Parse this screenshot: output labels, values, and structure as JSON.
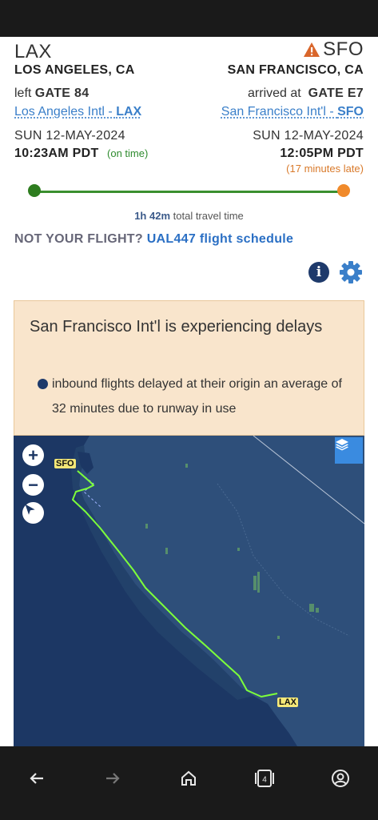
{
  "origin": {
    "code": "LAX",
    "city": "LOS ANGELES, CA",
    "gate_prefix": "left",
    "gate": "GATE 84",
    "airport_name": "Los Angeles Intl - ",
    "airport_code": "LAX",
    "date": "SUN 12-MAY-2024",
    "time": "10:23AM PDT",
    "status": "(on time)"
  },
  "destination": {
    "code": "SFO",
    "city": "SAN FRANCISCO, CA",
    "gate_prefix": "arrived at",
    "gate": "GATE E7",
    "airport_name": "San Francisco Int'l - ",
    "airport_code": "SFO",
    "date": "SUN 12-MAY-2024",
    "time": "12:05PM PDT",
    "status": "(17 minutes late)"
  },
  "progress": {
    "fraction": 1.0,
    "start_color": "#2e7d1f",
    "end_color": "#f08a2b"
  },
  "travel": {
    "duration": "1h 42m",
    "label": "total travel time"
  },
  "not_flight": {
    "prompt": "NOT YOUR FLIGHT?",
    "link": "UAL447 flight schedule"
  },
  "delay": {
    "title": "San Francisco Int'l is experiencing delays",
    "detail": "inbound flights delayed at their origin an average of 32 minutes due to runway in use"
  },
  "map": {
    "origin_label": "LAX",
    "destination_label": "SFO",
    "zoom_in": "+",
    "zoom_out": "−",
    "icons": [
      "zoom-in-icon",
      "zoom-out-icon",
      "compass-icon",
      "layers-icon"
    ],
    "route_color": "#7dff3a"
  },
  "nav": {
    "icons": [
      "back-arrow-icon",
      "forward-arrow-icon",
      "home-icon",
      "tabs-icon",
      "account-icon"
    ],
    "tab_count": "4"
  },
  "colors": {
    "link": "#3a7fc9",
    "warning": "#d9662b",
    "delay_bg": "#f9e5cc"
  }
}
